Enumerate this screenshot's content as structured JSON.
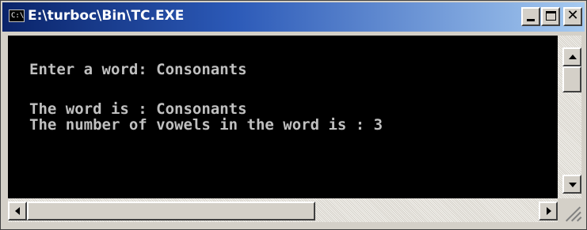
{
  "window": {
    "title": "E:\\turboc\\Bin\\TC.EXE",
    "icon_text": "C:\\",
    "buttons": {
      "minimize": "minimize-icon",
      "maximize": "maximize-icon",
      "close": "✕"
    }
  },
  "console": {
    "lines": [
      "Enter a word: Consonants",
      "The word is : Consonants",
      "The number of vowels in the word is : 3"
    ]
  },
  "colors": {
    "titlebar_start": "#0a246a",
    "titlebar_end": "#a6caf0",
    "console_bg": "#000000",
    "console_text": "#c0c0c0",
    "chrome": "#d4d0c8"
  },
  "icons": {
    "app": "console-app-icon",
    "scroll_up": "arrow-up-icon",
    "scroll_down": "arrow-down-icon",
    "scroll_left": "arrow-left-icon",
    "scroll_right": "arrow-right-icon",
    "size_grip": "size-grip-icon"
  }
}
